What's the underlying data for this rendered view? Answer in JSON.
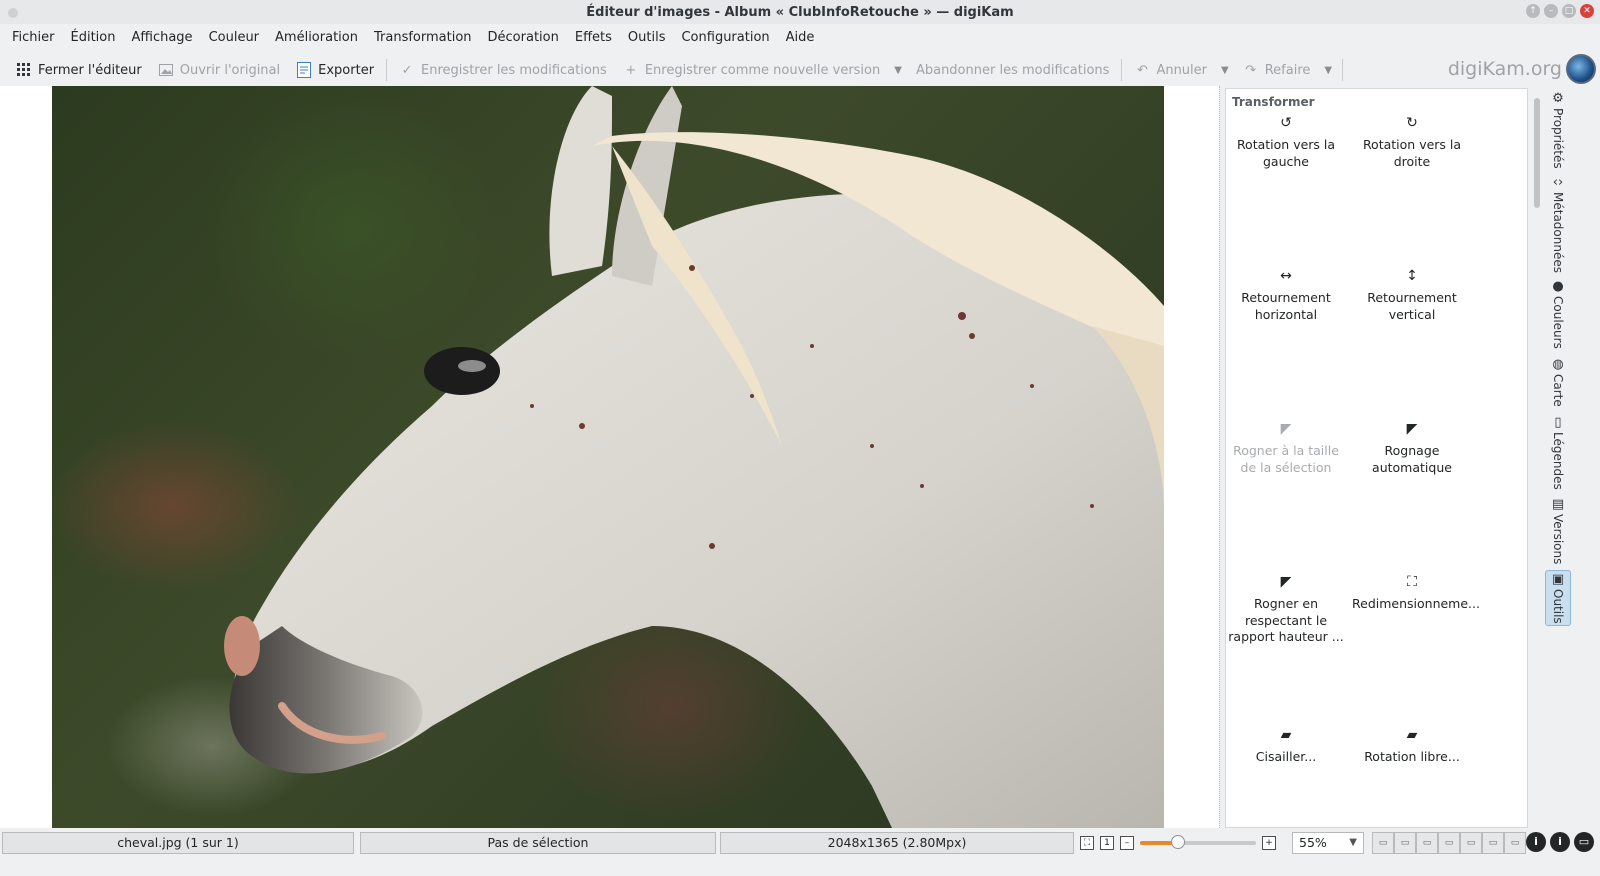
{
  "window": {
    "title": "Éditeur d'images - Album « ClubInfoRetouche » — digiKam"
  },
  "menu": [
    "Fichier",
    "Édition",
    "Affichage",
    "Couleur",
    "Amélioration",
    "Transformation",
    "Décoration",
    "Effets",
    "Outils",
    "Configuration",
    "Aide"
  ],
  "toolbar": {
    "close_editor": "Fermer l'éditeur",
    "open_original": "Ouvrir l'original",
    "export": "Exporter",
    "save_changes": "Enregistrer les modifications",
    "save_new_version": "Enregistrer comme nouvelle version",
    "discard_changes": "Abandonner les modifications",
    "undo": "Annuler",
    "redo": "Refaire"
  },
  "brand": "digiKam.org",
  "panel": {
    "title": "Transformer",
    "tools": [
      {
        "label": "Rotation vers la gauche",
        "icon": "rotate-left-icon",
        "enabled": true
      },
      {
        "label": "Rotation vers la droite",
        "icon": "rotate-right-icon",
        "enabled": true
      },
      {
        "label": "Retournement horizontal",
        "icon": "flip-horizontal-icon",
        "enabled": true
      },
      {
        "label": "Retournement vertical",
        "icon": "flip-vertical-icon",
        "enabled": true
      },
      {
        "label": "Rogner à la taille de la sélection",
        "icon": "crop-icon",
        "enabled": false
      },
      {
        "label": "Rognage automatique",
        "icon": "auto-crop-icon",
        "enabled": true
      },
      {
        "label": "Rogner en respectant le rapport hauteur ...",
        "icon": "ratio-crop-icon",
        "enabled": true
      },
      {
        "label": "Redimensionneme...",
        "icon": "resize-icon",
        "enabled": true
      },
      {
        "label": "Cisailler...",
        "icon": "shear-icon",
        "enabled": true
      },
      {
        "label": "Rotation libre...",
        "icon": "free-rotation-icon",
        "enabled": true
      }
    ]
  },
  "side_tabs": [
    {
      "label": "Propriétés",
      "icon": "gear-icon"
    },
    {
      "label": "Métadonnées",
      "icon": "code-icon"
    },
    {
      "label": "Couleurs",
      "icon": "drop-icon"
    },
    {
      "label": "Carte",
      "icon": "globe-icon"
    },
    {
      "label": "Légendes",
      "icon": "caption-icon"
    },
    {
      "label": "Versions",
      "icon": "versions-icon"
    },
    {
      "label": "Outils",
      "icon": "tools-icon",
      "active": true
    }
  ],
  "status": {
    "file": "cheval.jpg (1 sur 1)",
    "selection": "Pas de sélection",
    "dimensions": "2048x1365 (2.80Mpx)",
    "zoom": "55%",
    "zoom_level": 0.55
  }
}
